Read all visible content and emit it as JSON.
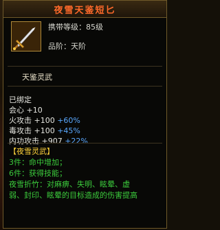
{
  "tooltip": {
    "title": "夜雪天鉴短匕",
    "icon": "dagger-icon",
    "level_text": "携带等级：85级",
    "grade_text": "品阶：天阶",
    "set_label": "天鉴灵武",
    "bound_text": "已绑定",
    "stats": [
      {
        "name": "会心",
        "value": "+10",
        "bonus": ""
      },
      {
        "name": "火攻击",
        "value": "+100",
        "bonus": "+60%"
      },
      {
        "name": "毒攻击",
        "value": "+100",
        "bonus": "+45%"
      },
      {
        "name": "内功攻击",
        "value": "+907",
        "bonus": "+22%"
      }
    ],
    "set_name": "【夜雪灵武】",
    "set_bonuses": [
      {
        "tier": "3件：",
        "text": "命中增加；"
      },
      {
        "tier": "6件：",
        "text": "获得技能；"
      }
    ],
    "skill_line1": "夜雪折竹：对麻痹、失明、眩晕、虚",
    "skill_line2": "弱、封印、眩晕的目标造成的伤害提高"
  },
  "colors": {
    "title": "#ff6a2a",
    "bonus": "#5aa8ff",
    "set_name": "#ffd23a",
    "set_tier": "#3ccb3c",
    "skill": "#3ccb3c"
  }
}
